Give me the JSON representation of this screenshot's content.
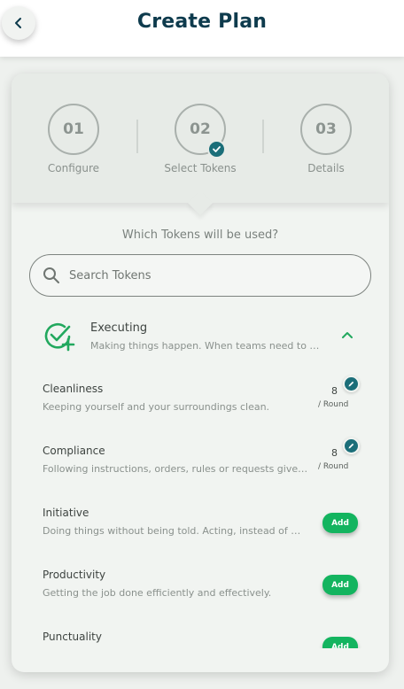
{
  "header": {
    "title": "Create Plan"
  },
  "stepper": {
    "steps": [
      {
        "number": "01",
        "label": "Configure"
      },
      {
        "number": "02",
        "label": "Select Tokens"
      },
      {
        "number": "03",
        "label": "Details"
      }
    ]
  },
  "selection": {
    "question": "Which Tokens will be used?",
    "search_placeholder": "Search Tokens"
  },
  "group": {
    "title": "Executing",
    "description": "Making things happen. When teams need to get things done."
  },
  "tokens": [
    {
      "name": "Cleanliness",
      "description": "Keeping yourself and your surroundings clean.",
      "value": "8",
      "unit": "/ Round",
      "state": "added"
    },
    {
      "name": "Compliance",
      "description": "Following instructions, orders, rules or requests given by others.",
      "value": "8",
      "unit": "/ Round",
      "state": "added"
    },
    {
      "name": "Initiative",
      "description": "Doing things without being told. Acting, instead of waiting.",
      "add_label": "Add",
      "state": "available"
    },
    {
      "name": "Productivity",
      "description": "Getting the job done efficiently and effectively.",
      "add_label": "Add",
      "state": "available"
    },
    {
      "name": "Punctuality",
      "description": "",
      "add_label": "Add",
      "state": "available"
    }
  ],
  "colors": {
    "brand_dark": "#0e3b4d",
    "teal": "#1b6e79",
    "add_green": "#13b45f",
    "group_icon_green": "#22a85e"
  },
  "icons": {
    "back": "chevron-left-icon",
    "check": "check-icon",
    "search": "search-icon",
    "group": "check-plus-icon",
    "collapse": "chevron-up-icon",
    "edit": "pencil-icon"
  }
}
